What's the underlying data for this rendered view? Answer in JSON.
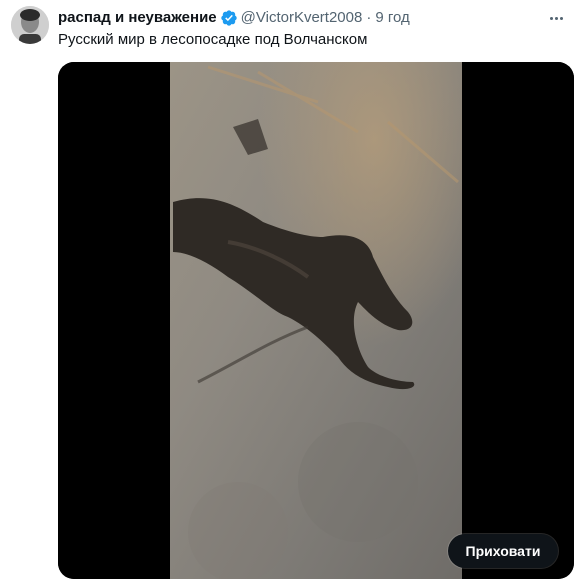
{
  "tweet": {
    "display_name": "распад и неуважение",
    "verified_icon": "verified-badge-icon",
    "handle": "@VictorKvert2008",
    "separator": "·",
    "time": "9 год",
    "text": "Русский мир в лесопосадке под Волчанском"
  },
  "media": {
    "hide_button_label": "Приховати"
  },
  "colors": {
    "verified": "#1d9bf0",
    "text": "#0f1419",
    "secondary": "#536471",
    "button_bg": "#0f1419"
  }
}
